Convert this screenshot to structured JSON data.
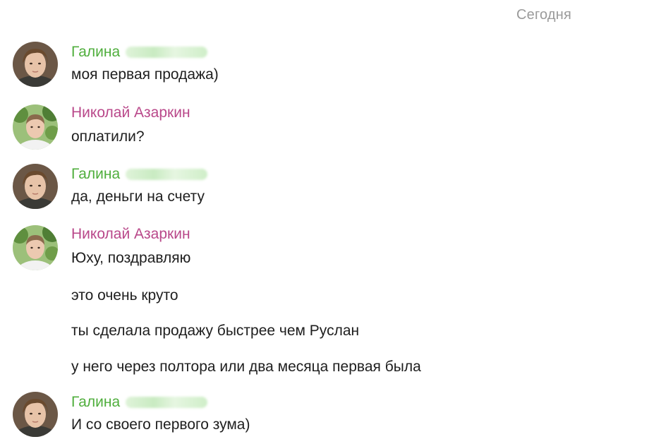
{
  "date_label": "Сегодня",
  "messages": [
    {
      "author": "Галина",
      "avatar": "avatar-galina",
      "lines": [
        "моя первая продажа)"
      ]
    },
    {
      "author": "Николай Азаркин",
      "avatar": "avatar-nikolai",
      "lines": [
        "оплатили?"
      ]
    },
    {
      "author": "Галина",
      "avatar": "avatar-galina",
      "lines": [
        "да, деньги на счету"
      ]
    },
    {
      "author": "Николай Азаркин",
      "avatar": "avatar-nikolai",
      "lines": [
        "Юху, поздравляю",
        "это очень круто",
        "ты сделала продажу быстрее чем Руслан",
        "у него через полтора или два месяца первая была"
      ]
    },
    {
      "author": "Галина",
      "avatar": "avatar-galina",
      "lines": [
        "И со своего первого зума)"
      ]
    }
  ],
  "colors": {
    "author_galina": "#4fae3c",
    "author_nikolai": "#b9488a",
    "date_label": "#9a9a9a",
    "text": "#1e1e1e"
  }
}
